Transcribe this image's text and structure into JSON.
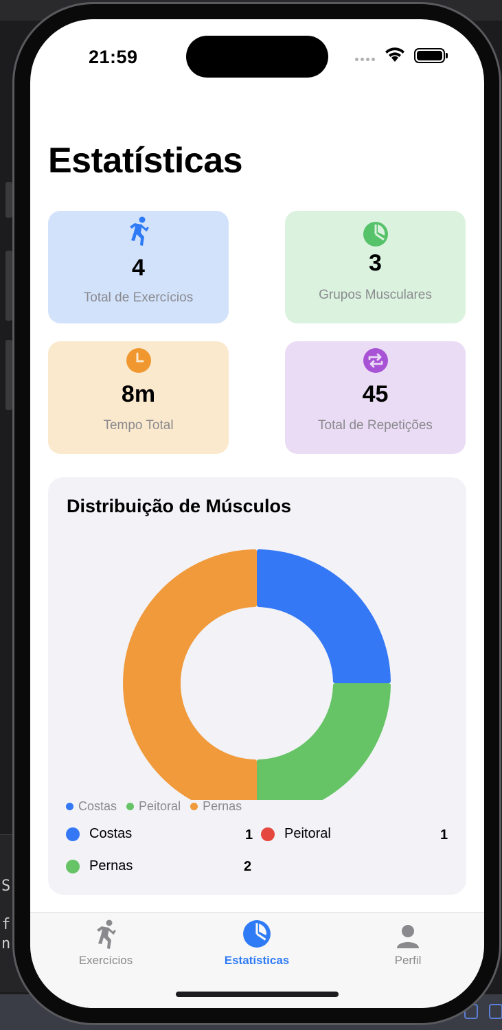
{
  "status_bar": {
    "time": "21:59"
  },
  "page": {
    "title": "Estatísticas"
  },
  "cards": [
    {
      "value": "4",
      "label": "Total de Exercícios",
      "icon": "running-figure-icon",
      "color": "#2f7bf5"
    },
    {
      "value": "3",
      "label": "Grupos Musculares",
      "icon": "pie-chart-icon",
      "color": "#56c26a"
    },
    {
      "value": "8m",
      "label": "Tempo Total",
      "icon": "clock-icon",
      "color": "#f0982f"
    },
    {
      "value": "45",
      "label": "Total de Repetições",
      "icon": "repeat-icon",
      "color": "#a852d6"
    }
  ],
  "chart": {
    "title": "Distribuição de Músculos",
    "legend": [
      "Costas",
      "Peitoral",
      "Pernas"
    ],
    "breakdown": [
      {
        "label": "Costas",
        "count": "1",
        "color": "#3478f6"
      },
      {
        "label": "Peitoral",
        "count": "1",
        "color": "#e5483e"
      },
      {
        "label": "Pernas",
        "count": "2",
        "color": "#66c466"
      }
    ]
  },
  "chart_data": {
    "type": "pie",
    "title": "Distribuição de Músculos",
    "categories": [
      "Costas",
      "Peitoral",
      "Pernas"
    ],
    "values": [
      1,
      1,
      2
    ],
    "colors": [
      "#3478f6",
      "#66c466",
      "#f09a3b"
    ],
    "legend_position": "bottom"
  },
  "tabbar": {
    "tabs": [
      {
        "label": "Exercícios",
        "icon": "running-figure-icon",
        "active": false
      },
      {
        "label": "Estatísticas",
        "icon": "pie-chart-icon",
        "active": true
      },
      {
        "label": "Perfil",
        "icon": "person-icon",
        "active": false
      }
    ]
  },
  "background": {
    "left_text": [
      "S",
      "f",
      "n"
    ]
  }
}
